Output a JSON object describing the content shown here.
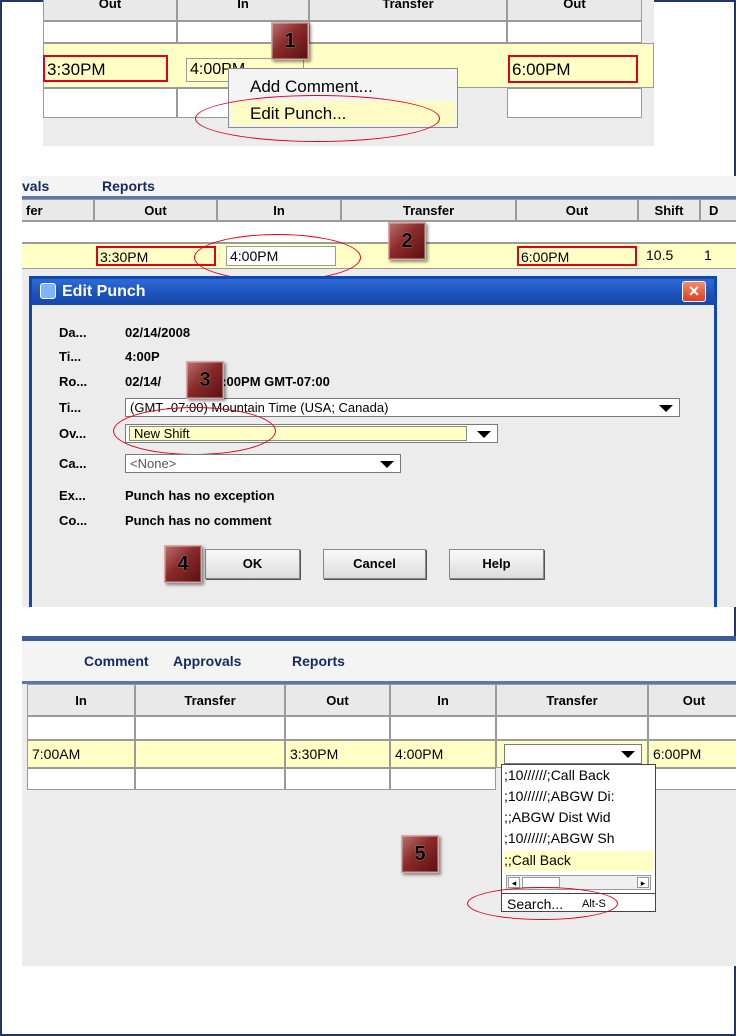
{
  "badges": [
    "1",
    "2",
    "3",
    "4",
    "5"
  ],
  "panel1": {
    "headers": [
      "Out",
      "In",
      "Transfer",
      "Out"
    ],
    "out_time": "3:30PM",
    "in_time": "4:00PM",
    "out_time2": "6:00PM",
    "context_menu": [
      "Add Comment...",
      "Edit Punch..."
    ]
  },
  "panel2": {
    "nav": [
      "vals",
      "Reports"
    ],
    "headers": [
      "fer",
      "Out",
      "In",
      "Transfer",
      "Out",
      "Shift",
      "D"
    ],
    "out_time": "3:30PM",
    "in_time": "4:00PM",
    "out_time2": "6:00PM",
    "shift": "10.5",
    "d_value": "1",
    "dialog": {
      "title": "Edit Punch",
      "rows": [
        {
          "label": "Da...",
          "value": "02/14/2008"
        },
        {
          "label": "Ti...",
          "value": "4:00P"
        },
        {
          "label": "Ro...",
          "value": "02/14/",
          "value2": "4:00PM GMT-07:00"
        },
        {
          "label": "Ti...",
          "select": "(GMT -07:00) Mountain Time (USA; Canada)"
        },
        {
          "label": "Ov...",
          "select": "New Shift"
        },
        {
          "label": "Ca...",
          "select": "<None>"
        },
        {
          "label": "Ex...",
          "value": "Punch has no exception"
        },
        {
          "label": "Co...",
          "value": "Punch has no comment"
        }
      ],
      "buttons": [
        "OK",
        "Cancel",
        "Help"
      ],
      "close_label": "×"
    }
  },
  "panel3": {
    "nav": [
      "Comment",
      "Approvals",
      "Reports"
    ],
    "headers": [
      "In",
      "Transfer",
      "Out",
      "In",
      "Transfer",
      "Out"
    ],
    "row": {
      "in1": "7:00AM",
      "out1": "3:30PM",
      "in2": "4:00PM",
      "out2": "6:00PM"
    },
    "dropdown": [
      ";10//////;Call Back",
      ";10//////;ABGW Di:",
      ";;ABGW Dist Wid",
      ";10//////;ABGW Sh",
      ";;Call Back"
    ],
    "search": "Search...",
    "search_shortcut": "Alt-S"
  },
  "colors": {
    "highlight": "#ffffc6",
    "red": "#e0001a",
    "navy": "#152a5e",
    "title_blue": "#1b51b8"
  }
}
